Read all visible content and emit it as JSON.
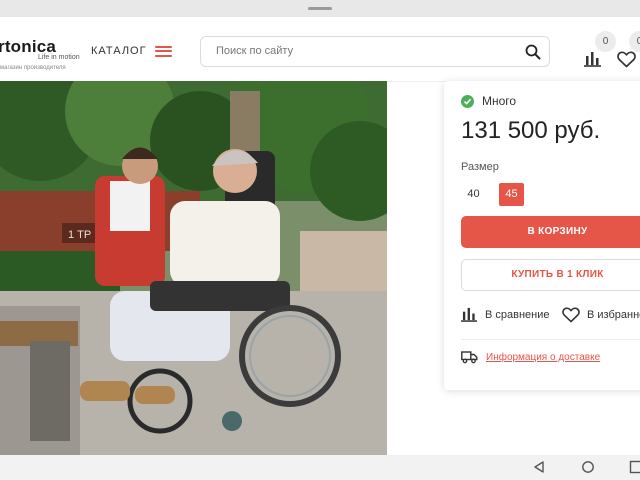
{
  "header": {
    "logo_text": "rtonica",
    "logo_sub": "Life in motion",
    "logo_tag": "магазин производителя",
    "catalog_label": "КАТАЛОГ",
    "search_placeholder": "Поиск по сайту",
    "compare_count": "0",
    "favorites_count": "0"
  },
  "photo": {
    "alt": "Мальчик и пожилая женщина в кресле-коляске в парке",
    "sign_text": "1 ТР"
  },
  "product": {
    "availability": "Много",
    "price": "131 500 руб.",
    "size_label": "Размер",
    "sizes": [
      "40",
      "45"
    ],
    "selected_size": "45",
    "cart_button": "В КОРЗИНУ",
    "one_click_button": "КУПИТЬ В 1 КЛИК",
    "compare_label": "В сравнение",
    "favorites_label": "В избранное",
    "delivery_link": "Информация о доставке"
  },
  "colors": {
    "accent": "#e55548",
    "in_stock": "#4cb05a"
  }
}
